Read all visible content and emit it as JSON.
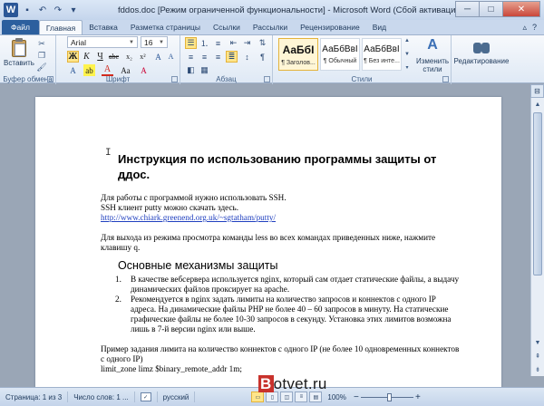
{
  "window": {
    "title": "fddos.doc [Режим ограниченной функциональности] - Microsoft Word (Сбой активации продукта)",
    "app_letter": "W",
    "minimize": "─",
    "maximize": "□",
    "close": "✕"
  },
  "tabs": [
    {
      "label": "Файл"
    },
    {
      "label": "Главная"
    },
    {
      "label": "Вставка"
    },
    {
      "label": "Разметка страницы"
    },
    {
      "label": "Ссылки"
    },
    {
      "label": "Рассылки"
    },
    {
      "label": "Рецензирование"
    },
    {
      "label": "Вид"
    }
  ],
  "ribbon": {
    "clipboard": {
      "paste": "Вставить",
      "label": "Буфер обмена"
    },
    "font": {
      "name": "Arial",
      "size": "16",
      "label": "Шрифт"
    },
    "paragraph": {
      "label": "Абзац"
    },
    "styles": {
      "items": [
        {
          "sample": "АаБбІ",
          "name": "¶ Заголов..."
        },
        {
          "sample": "АаБбВвІ",
          "name": "¶ Обычный"
        },
        {
          "sample": "АаБбВвІ",
          "name": "¶ Без инте..."
        }
      ],
      "change": "Изменить стили",
      "label": "Стили"
    },
    "editing": {
      "label": "Редактирование"
    }
  },
  "document": {
    "heading": "Инструкция по использованию программы защиты от ддос.",
    "intro_lines": [
      "Для работы с программой нужно использовать SSH.",
      "SSH клиент putty можно скачать здесь."
    ],
    "link": "http://www.chiark.greenend.org.uk/~sgtatham/putty/",
    "less_note": "Для выхода из режима просмотра команды less во всех командах приведенных ниже, нажмите клавишу q.",
    "section_heading": "Основные механизмы защиты",
    "list": [
      {
        "num": "1.",
        "text": "В качестве вебсервера используется nginx, который сам отдает статические файлы, а выдачу динамических файлов проксирует на apache."
      },
      {
        "num": "2.",
        "text": "Рекомендуется в nginx задать лимиты на количество запросов и коннектов с одного IP адреса. На динамические файлы PHP не более 40 – 60 запросов в минуту. На статические графические файлы не более 10-30 запросов в секунду. Установка этих лимитов возможна лишь в 7-й версии nginx или выше."
      }
    ],
    "example": "Пример задания лимита на количество коннектов с одного IP (не более 10 одновременных коннектов с одного IP)",
    "cut_line": "limit_zone   limz  $binary_remote_addr  1m;"
  },
  "statusbar": {
    "page": "Страница: 1 из 3",
    "words": "Число слов: 1 ...",
    "language": "русский",
    "zoom": "100%"
  },
  "watermark": {
    "b": "B",
    "rest": "otvet.ru"
  }
}
